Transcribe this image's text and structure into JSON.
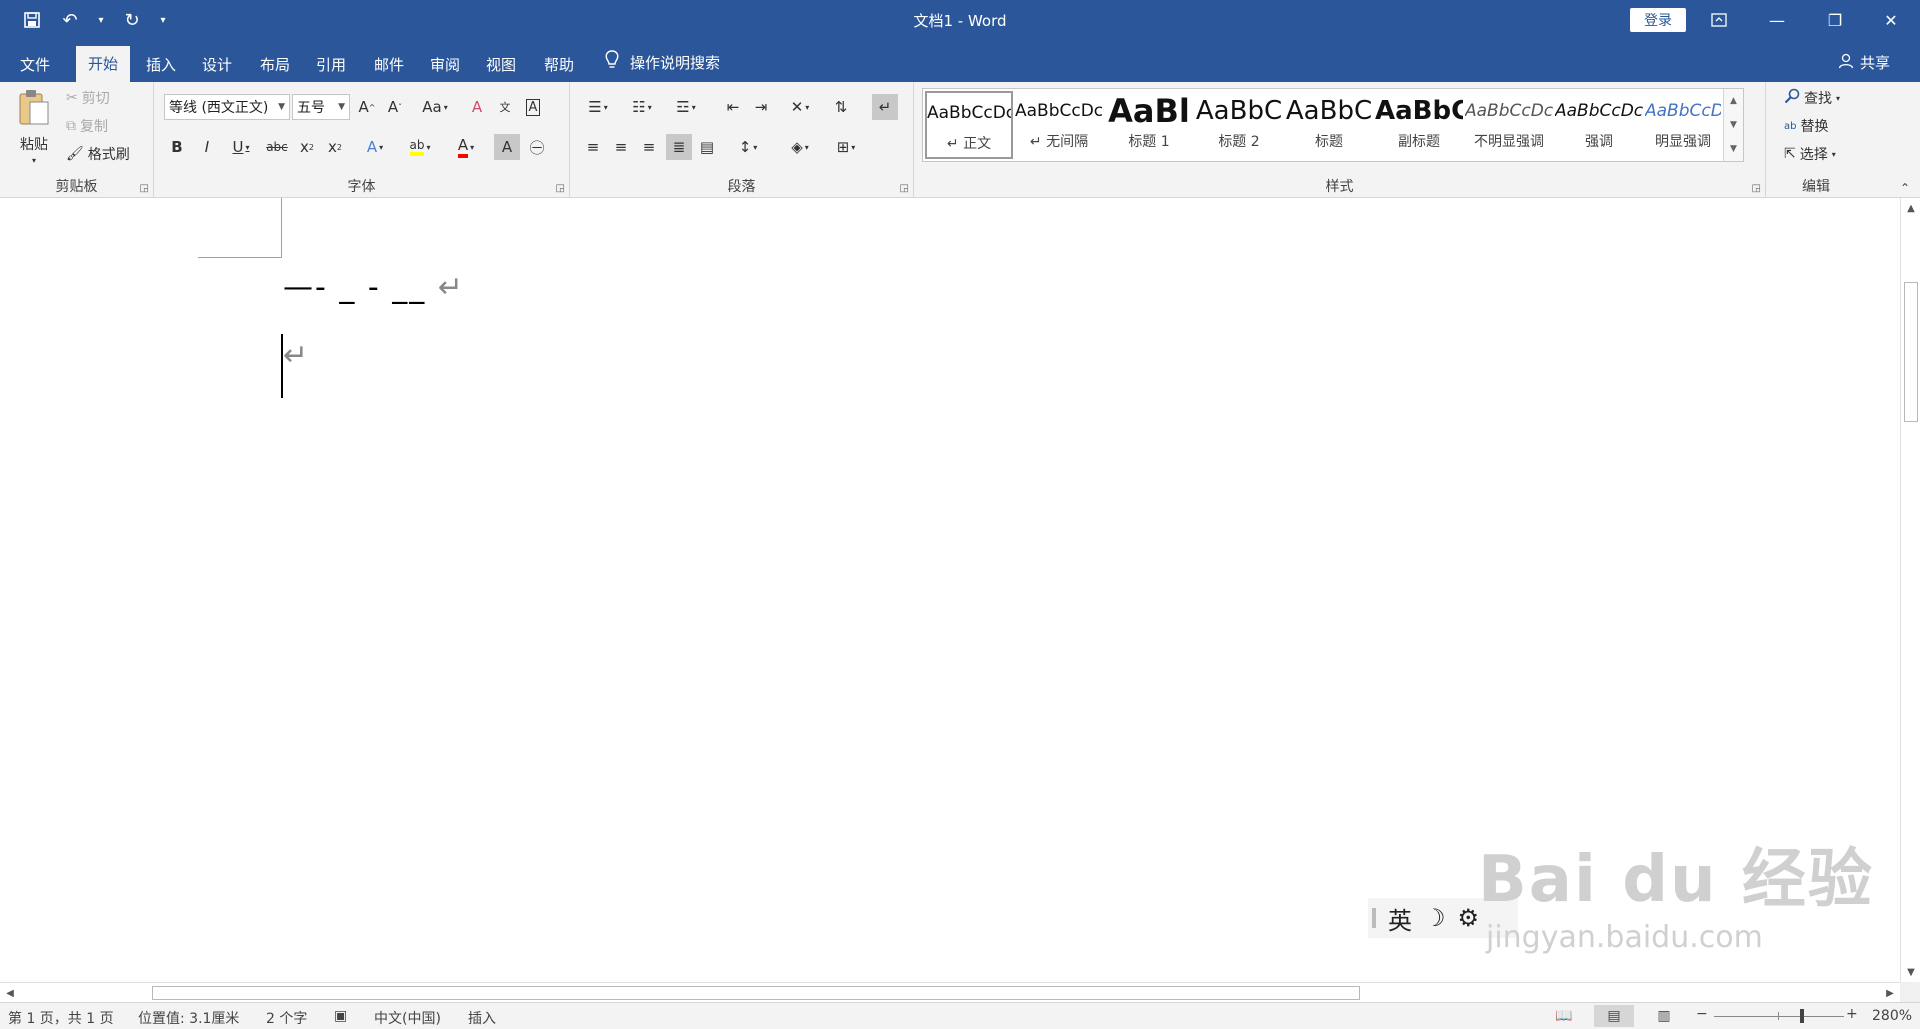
{
  "titlebar": {
    "title": "文档1  -  Word",
    "login": "登录",
    "icons": [
      "save-icon",
      "undo-icon",
      "redo-icon",
      "customize-qat-icon"
    ]
  },
  "tabs": [
    {
      "label": "文件"
    },
    {
      "label": "开始"
    },
    {
      "label": "插入"
    },
    {
      "label": "设计"
    },
    {
      "label": "布局"
    },
    {
      "label": "引用"
    },
    {
      "label": "邮件"
    },
    {
      "label": "审阅"
    },
    {
      "label": "视图"
    },
    {
      "label": "帮助"
    }
  ],
  "tellme": "操作说明搜索",
  "share": "共享",
  "clipboard": {
    "paste": "粘贴",
    "cut": "剪切",
    "copy": "复制",
    "format_painter": "格式刷",
    "label": "剪贴板"
  },
  "font": {
    "name": "等线 (西文正文)",
    "size": "五号",
    "label": "字体"
  },
  "paragraph": {
    "label": "段落"
  },
  "styles": {
    "label": "样式",
    "items": [
      {
        "sample": "AaBbCcDc",
        "name": "↵ 正文"
      },
      {
        "sample": "AaBbCcDc",
        "name": "↵ 无间隔"
      },
      {
        "sample": "AaBl",
        "name": "标题 1"
      },
      {
        "sample": "AaBbC",
        "name": "标题 2"
      },
      {
        "sample": "AaBbC",
        "name": "标题"
      },
      {
        "sample": "AaBbC",
        "name": "副标题"
      },
      {
        "sample": "AaBbCcDc",
        "name": "不明显强调"
      },
      {
        "sample": "AaBbCcDc",
        "name": "强调"
      },
      {
        "sample": "AaBbCcDc",
        "name": "明显强调"
      }
    ]
  },
  "editing": {
    "find": "查找",
    "replace": "替换",
    "select": "选择",
    "label": "编辑"
  },
  "document": {
    "line1": "—- _ - __",
    "return_mark": "↵"
  },
  "ime": {
    "lang": "英"
  },
  "watermark": {
    "top": "Bai du 经验",
    "bottom": "jingyan.baidu.com"
  },
  "status": {
    "page": "第 1 页，共 1 页",
    "position": "位置值: 3.1厘米",
    "words": "2 个字",
    "language": "中文(中国)",
    "mode": "插入",
    "zoom": "280%"
  },
  "colors": {
    "brand": "#2b579a",
    "highlight": "#ffff00",
    "font_color": "#ff0000"
  }
}
